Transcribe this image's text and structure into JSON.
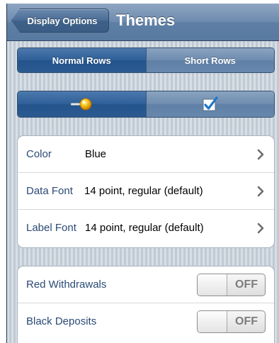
{
  "navbar": {
    "back_label": "Display Options",
    "title": "Themes"
  },
  "row_height_segment": {
    "options": [
      "Normal Rows",
      "Short Rows"
    ],
    "selected": "Normal Rows"
  },
  "icon_segment": {
    "options": [
      "pin-icon",
      "checkbox-check-icon"
    ],
    "selected": "pin-icon"
  },
  "appearance_group": {
    "rows": [
      {
        "label": "Color",
        "value": "Blue"
      },
      {
        "label": "Data Font",
        "value": "14 point, regular (default)"
      },
      {
        "label": "Label Font",
        "value": "14 point, regular (default)"
      }
    ]
  },
  "toggles_group": {
    "rows": [
      {
        "label": "Red Withdrawals",
        "state": "OFF"
      },
      {
        "label": "Black Deposits",
        "state": "OFF"
      }
    ]
  },
  "colors": {
    "accent": "#2e5f98",
    "label_text": "#2a4a75"
  }
}
